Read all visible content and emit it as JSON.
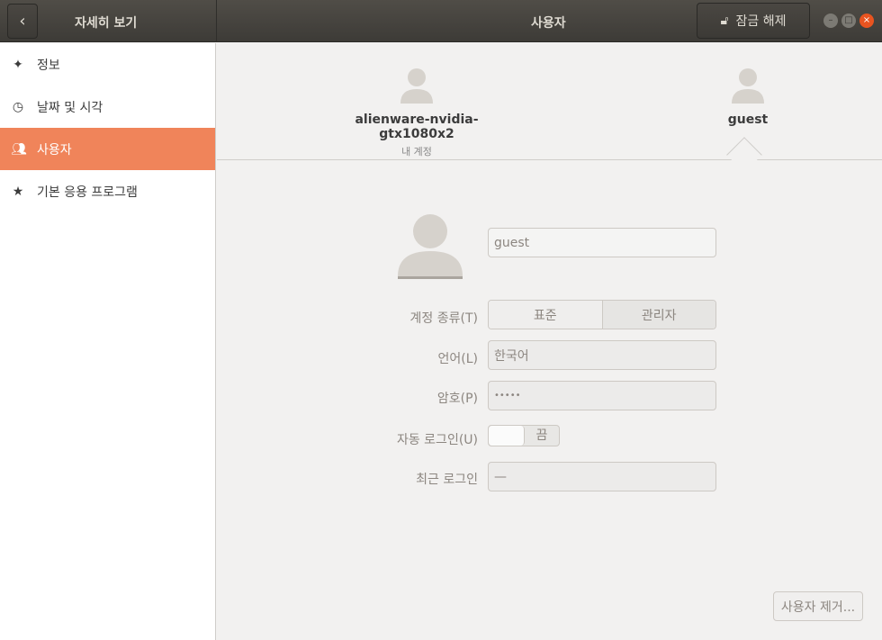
{
  "header": {
    "sidebar_title": "자세히 보기",
    "title": "사용자",
    "unlock_label": "잠금 해제"
  },
  "sidebar": {
    "items": [
      {
        "label": "정보",
        "icon": "sparkle-icon"
      },
      {
        "label": "날짜 및 시각",
        "icon": "clock-icon"
      },
      {
        "label": "사용자",
        "icon": "users-icon",
        "active": true
      },
      {
        "label": "기본 응용 프로그램",
        "icon": "star-icon"
      }
    ]
  },
  "users": [
    {
      "name": "alienware-nvidia-gtx1080x2",
      "sub": "내 계정"
    },
    {
      "name": "guest",
      "selected": true
    }
  ],
  "form": {
    "name": "guest",
    "account_type_label": "계정 종류(T)",
    "account_types": [
      "표준",
      "관리자"
    ],
    "account_type_selected": "관리자",
    "language_label": "언어(L)",
    "language": "한국어",
    "password_label": "암호(P)",
    "password": "•••••",
    "autologin_label": "자동 로그인(U)",
    "autologin_state": "끔",
    "last_login_label": "최근 로그인",
    "last_login": "—",
    "remove_label": "사용자 제거..."
  },
  "colors": {
    "accent": "#f0845a"
  }
}
